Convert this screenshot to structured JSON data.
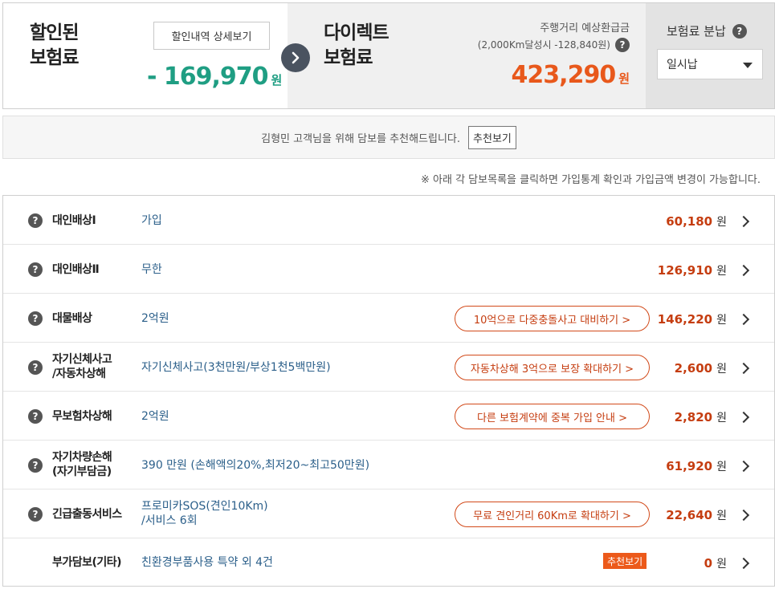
{
  "summary": {
    "discount_label_1": "할인된",
    "discount_label_2": "보험료",
    "detail_button": "할인내역 상세보기",
    "discount_amount": "- 169,970",
    "discount_unit": "원",
    "direct_label_1": "다이렉트",
    "direct_label_2": "보험료",
    "refund_title": "주행거리 예상환급금",
    "refund_detail": "(2,000Km달성시 -128,840원)",
    "direct_amount": "423,290",
    "direct_unit": "원",
    "pay_title": "보험료 분납",
    "pay_selected": "일시납"
  },
  "recommend": {
    "text": "김형민 고객님을 위해 담보를 추천해드립니다.",
    "button": "추천보기"
  },
  "notice": "※ 아래 각 담보목록을 클릭하면 가입통계 확인과 가입금액 변경이 가능합니다.",
  "coverages": [
    {
      "name": "대인배상Ⅰ",
      "value": "가입",
      "pill": "",
      "amount": "60,180",
      "unit": "원",
      "help": "?"
    },
    {
      "name": "대인배상Ⅱ",
      "value": "무한",
      "pill": "",
      "amount": "126,910",
      "unit": "원",
      "help": "?"
    },
    {
      "name": "대물배상",
      "value": "2억원",
      "pill": "10억으로 다중충돌사고 대비하기 >",
      "amount": "146,220",
      "unit": "원",
      "help": "?"
    },
    {
      "name_1": "자기신체사고",
      "name_2": "/자동차상해",
      "value": "자기신체사고(3천만원/부상1천5백만원)",
      "pill": "자동차상해 3억으로 보장 확대하기 >",
      "amount": "2,600",
      "unit": "원",
      "help": "?"
    },
    {
      "name": "무보험차상해",
      "value": "2억원",
      "pill": "다른 보험계약에 중복 가입 안내 >",
      "amount": "2,820",
      "unit": "원",
      "help": "?"
    },
    {
      "name_1": "자기차량손해",
      "name_2": "(자기부담금)",
      "value": "390 만원 (손해액의20%,최저20~최고50만원)",
      "pill": "",
      "amount": "61,920",
      "unit": "원",
      "help": "?"
    },
    {
      "name": "긴급출동서비스",
      "value_1": "프로미카SOS(견인10Km)",
      "value_2": "/서비스 6회",
      "pill": "무료 견인거리 60Km로 확대하기 >",
      "amount": "22,640",
      "unit": "원",
      "help": "?"
    },
    {
      "name": "부가담보(기타)",
      "value": "친환경부품사용 특약 외 4건",
      "badge": "추천보기",
      "amount": "0",
      "unit": "원"
    }
  ],
  "colors": {
    "discount_green": "#1f9e83",
    "direct_orange": "#e8581b",
    "amount_red": "#c53d10",
    "value_blue": "#2b5f8a"
  },
  "icons": {
    "help": "question-circle-icon",
    "arrow": "arrow-right-circle-icon",
    "row_chevron": "chevron-right-icon",
    "dropdown": "caret-down-icon"
  }
}
